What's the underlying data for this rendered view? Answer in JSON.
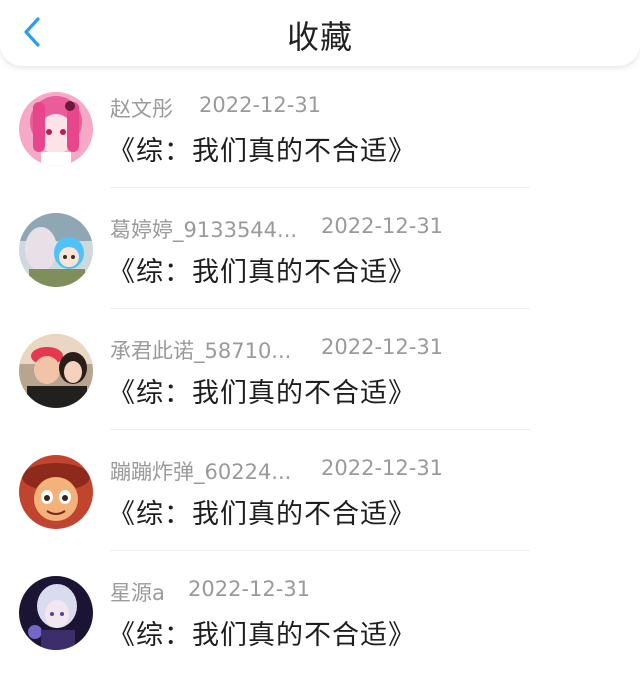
{
  "header": {
    "title": "收藏",
    "back_icon": "chevron-left-icon",
    "accent_color": "#2d9bf0"
  },
  "items": [
    {
      "user": "赵文彤",
      "date": "2022-12-31",
      "work": "《综：我们真的不合适》"
    },
    {
      "user": "葛婷婷_9133544...",
      "date": "2022-12-31",
      "work": "《综：我们真的不合适》"
    },
    {
      "user": "承君此诺_58710...",
      "date": "2022-12-31",
      "work": "《综：我们真的不合适》"
    },
    {
      "user": "蹦蹦炸弹_60224...",
      "date": "2022-12-31",
      "work": "《综：我们真的不合适》"
    },
    {
      "user": "星源a",
      "date": "2022-12-31",
      "work": "《综：我们真的不合适》"
    }
  ]
}
